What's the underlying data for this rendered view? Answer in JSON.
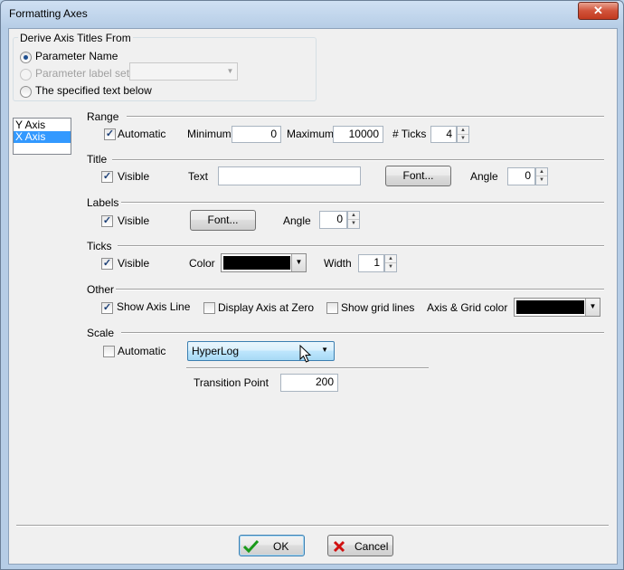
{
  "window": {
    "title": "Formatting Axes",
    "close_label": "✕"
  },
  "derive": {
    "title": "Derive Axis Titles From",
    "option_parameter_name": "Parameter Name",
    "option_parameter_label_set": "Parameter label set",
    "option_specified_text": "The specified text below",
    "selected": "Parameter Name"
  },
  "axis_list": {
    "items": [
      "Y Axis",
      "X Axis"
    ],
    "selected": "X Axis"
  },
  "range": {
    "title": "Range",
    "automatic_label": "Automatic",
    "automatic_checked": true,
    "minimum_label": "Minimum",
    "minimum_value": "0",
    "maximum_label": "Maximum",
    "maximum_value": "10000",
    "ticks_label": "# Ticks",
    "ticks_value": "4"
  },
  "title_section": {
    "title": "Title",
    "visible_label": "Visible",
    "visible_checked": true,
    "text_label": "Text",
    "text_value": "",
    "font_button": "Font...",
    "angle_label": "Angle",
    "angle_value": "0"
  },
  "labels": {
    "title": "Labels",
    "visible_label": "Visible",
    "visible_checked": true,
    "font_button": "Font...",
    "angle_label": "Angle",
    "angle_value": "0"
  },
  "ticks": {
    "title": "Ticks",
    "visible_label": "Visible",
    "visible_checked": true,
    "color_label": "Color",
    "color_value": "#000000",
    "width_label": "Width",
    "width_value": "1"
  },
  "other": {
    "title": "Other",
    "show_axis_line_label": "Show Axis Line",
    "show_axis_line_checked": true,
    "display_axis_zero_label": "Display Axis at Zero",
    "display_axis_zero_checked": false,
    "show_grid_lines_label": "Show grid lines",
    "show_grid_lines_checked": false,
    "axis_grid_color_label": "Axis & Grid color",
    "axis_grid_color_value": "#000000"
  },
  "scale": {
    "title": "Scale",
    "automatic_label": "Automatic",
    "automatic_checked": false,
    "type_value": "HyperLog",
    "transition_point_label": "Transition Point",
    "transition_point_value": "200"
  },
  "footer": {
    "ok_label": "OK",
    "cancel_label": "Cancel"
  },
  "icons": {
    "ok": "check-icon",
    "cancel": "x-icon",
    "cursor": "mouse-pointer-icon"
  }
}
